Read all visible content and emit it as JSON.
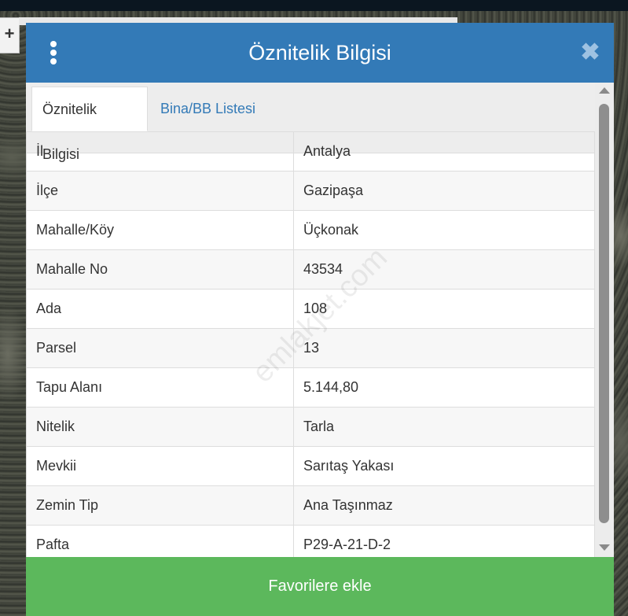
{
  "dialog": {
    "title": "Öznitelik Bilgisi",
    "close_symbol": "✖"
  },
  "map": {
    "zoom_in": "+"
  },
  "tabs": [
    {
      "label": "Öznitelik Bilgisi",
      "active": true
    },
    {
      "label": "Bina/BB Listesi",
      "active": false
    }
  ],
  "attributes": [
    {
      "key": "İl",
      "value": "Antalya"
    },
    {
      "key": "İlçe",
      "value": "Gazipaşa"
    },
    {
      "key": "Mahalle/Köy",
      "value": "Üçkonak"
    },
    {
      "key": "Mahalle No",
      "value": "43534"
    },
    {
      "key": "Ada",
      "value": "108"
    },
    {
      "key": "Parsel",
      "value": "13"
    },
    {
      "key": "Tapu Alanı",
      "value": "5.144,80"
    },
    {
      "key": "Nitelik",
      "value": "Tarla"
    },
    {
      "key": "Mevkii",
      "value": "Sarıtaş Yakası"
    },
    {
      "key": "Zemin Tip",
      "value": "Ana Taşınmaz"
    },
    {
      "key": "Pafta",
      "value": "P29-A-21-D-2"
    }
  ],
  "footer": {
    "favorite_label": "Favorilere ekle"
  },
  "watermark": "emlakjet.com",
  "colors": {
    "header": "#337ab7",
    "favorite_button": "#5cb85c",
    "link": "#337ab7"
  },
  "icons": [
    "vertical-dots-menu-icon",
    "close-icon",
    "scroll-up-icon",
    "scroll-down-icon",
    "zoom-in-icon"
  ]
}
